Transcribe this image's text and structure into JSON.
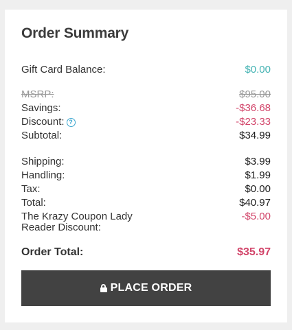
{
  "summary": {
    "title": "Order Summary",
    "gift_card": {
      "label": "Gift Card Balance:",
      "value": "$0.00"
    },
    "msrp": {
      "label": "MSRP:",
      "value": "$95.00"
    },
    "savings": {
      "label": "Savings:",
      "value": "-$36.68"
    },
    "discount": {
      "label": "Discount:",
      "value": "-$23.33",
      "help_icon": "question-circle-icon",
      "help_glyph": "?"
    },
    "subtotal": {
      "label": "Subtotal:",
      "value": "$34.99"
    },
    "shipping": {
      "label": "Shipping:",
      "value": "$3.99"
    },
    "handling": {
      "label": "Handling:",
      "value": "$1.99"
    },
    "tax": {
      "label": "Tax:",
      "value": "$0.00"
    },
    "total": {
      "label": "Total:",
      "value": "$40.97"
    },
    "reader_discount": {
      "label_line1": "The Krazy Coupon Lady",
      "label_line2": "Reader Discount:",
      "value": "-$5.00"
    },
    "order_total": {
      "label": "Order Total:",
      "value": "$35.97"
    }
  },
  "actions": {
    "place_order_label": "PLACE ORDER",
    "place_order_icon": "lock-icon"
  },
  "colors": {
    "teal": "#44b3b3",
    "negative": "#d2456a",
    "button_bg": "#424242",
    "muted": "#999999"
  }
}
